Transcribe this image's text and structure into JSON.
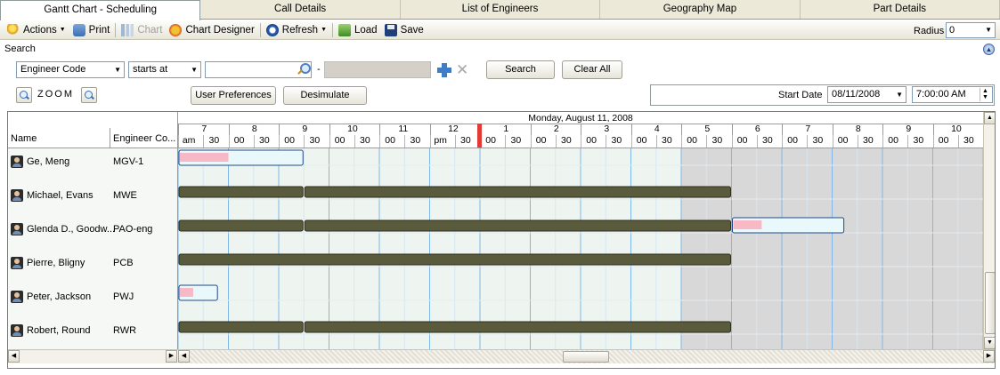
{
  "tabs": [
    {
      "label": "Gantt Chart - Scheduling",
      "active": true
    },
    {
      "label": "Call Details",
      "active": false
    },
    {
      "label": "List of Engineers",
      "active": false
    },
    {
      "label": "Geography Map",
      "active": false
    },
    {
      "label": "Part Details",
      "active": false
    }
  ],
  "toolbar": {
    "actions": "Actions",
    "print": "Print",
    "chart": "Chart",
    "chart_designer": "Chart Designer",
    "refresh": "Refresh",
    "load": "Load",
    "save": "Save",
    "radius_label": "Radius",
    "radius_value": "0"
  },
  "search": {
    "header": "Search",
    "field": "Engineer Code",
    "operator": "starts at",
    "value": "",
    "separator": "-",
    "search_button": "Search",
    "clear_button": "Clear All"
  },
  "zoom": {
    "label": "ZOOM",
    "user_preferences": "User Preferences",
    "desimulate": "Desimulate",
    "start_date_label": "Start Date",
    "start_date": "08/11/2008",
    "start_time": "7:00:00 AM"
  },
  "gantt": {
    "date": "Monday, August 11, 2008",
    "col_name": "Name",
    "col_code": "Engineer Co...",
    "hours": [
      "7",
      "8",
      "9",
      "10",
      "11",
      "12",
      "1",
      "2",
      "3",
      "4",
      "5",
      "6",
      "7",
      "8",
      "9",
      "10"
    ],
    "half_labels": [
      "am",
      "30",
      "00",
      "30",
      "00",
      "30",
      "00",
      "30",
      "00",
      "30",
      "pm",
      "30",
      "00",
      "30",
      "00",
      "30",
      "00",
      "30",
      "00",
      "30",
      "00",
      "30",
      "00",
      "30",
      "00",
      "30",
      "00",
      "30",
      "00",
      "30",
      "00",
      "30"
    ],
    "current_time_hours": 13.0,
    "nonworking_from_hours": 17.0,
    "engineers": [
      {
        "name": "Ge, Meng",
        "code": "MGV-1",
        "bars": [
          {
            "type": "call",
            "start_h": 7.0,
            "end_h": 9.5,
            "progress_end_h": 8.0
          }
        ]
      },
      {
        "name": "Michael, Evans",
        "code": "MWE",
        "bars": [
          {
            "type": "work",
            "start_h": 7.0,
            "end_h": 9.5
          },
          {
            "type": "work",
            "start_h": 9.5,
            "end_h": 18.0
          }
        ]
      },
      {
        "name": "Glenda D., Goodw...",
        "code": "PAO-eng",
        "bars": [
          {
            "type": "work",
            "start_h": 7.0,
            "end_h": 9.5
          },
          {
            "type": "work",
            "start_h": 9.5,
            "end_h": 18.0
          },
          {
            "type": "call",
            "start_h": 18.0,
            "end_h": 20.25,
            "progress_end_h": 18.6
          }
        ]
      },
      {
        "name": "Pierre, Bligny",
        "code": "PCB",
        "bars": [
          {
            "type": "work",
            "start_h": 7.0,
            "end_h": 18.0
          }
        ]
      },
      {
        "name": "Peter, Jackson",
        "code": "PWJ",
        "bars": [
          {
            "type": "call",
            "start_h": 7.0,
            "end_h": 7.8,
            "progress_end_h": 7.3
          }
        ]
      },
      {
        "name": "Robert, Round",
        "code": "RWR",
        "bars": [
          {
            "type": "work",
            "start_h": 7.0,
            "end_h": 9.5
          },
          {
            "type": "work",
            "start_h": 9.5,
            "end_h": 18.0
          }
        ]
      }
    ]
  },
  "colors": {
    "work_bar": "#5a5a3c",
    "call_bar": "#e9f9fb",
    "call_progress": "#f7b9c6",
    "now_line": "#e53935",
    "hour_grid": "#7fb8e8",
    "half_grid": "#d6e6f2",
    "weekend_shade": "#d8d8d8"
  }
}
